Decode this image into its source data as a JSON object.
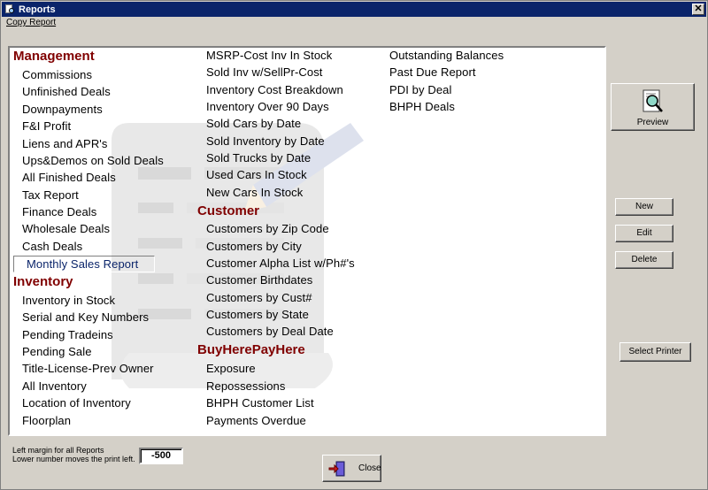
{
  "window": {
    "title": "Reports",
    "close_glyph": "✕"
  },
  "menu": {
    "copy_report": "Copy Report"
  },
  "columns": {
    "col1": {
      "management_header": "Management",
      "management_items": [
        "Commissions",
        "Unfinished Deals",
        "Downpayments",
        "F&I Profit",
        "Liens and APR's",
        "Ups&Demos on Sold Deals",
        "All Finished Deals",
        "Tax Report",
        "Finance Deals",
        "Wholesale Deals",
        "Cash Deals"
      ],
      "selected_item": "Monthly Sales Report",
      "inventory_header": "Inventory",
      "inventory_items": [
        "Inventory in Stock",
        "Serial and Key Numbers",
        "Pending Tradeins",
        "Pending Sale",
        "Title-License-Prev Owner",
        "All Inventory",
        "Location of Inventory",
        "Floorplan"
      ]
    },
    "col2": {
      "inventory_items": [
        "MSRP-Cost Inv In Stock",
        "Sold Inv w/SellPr-Cost",
        "Inventory Cost Breakdown",
        "Inventory Over 90 Days",
        "Sold Cars by Date",
        "Sold Inventory by Date",
        "Sold Trucks by Date",
        "Used Cars In Stock",
        "New Cars In Stock"
      ],
      "customer_header": "Customer",
      "customer_items": [
        "Customers by Zip Code",
        "Customers by City",
        "Customer Alpha List w/Ph#'s",
        "Customer Birthdates",
        "Customers by Cust#",
        "Customers by State",
        "Customers by Deal Date"
      ],
      "bhph_header": "BuyHerePayHere",
      "bhph_items": [
        "Exposure",
        "Repossessions",
        "BHPH Customer List",
        "Payments Overdue"
      ]
    },
    "col3": {
      "items": [
        "Outstanding Balances",
        "Past Due Report",
        "PDI by Deal",
        "BHPH Deals"
      ]
    }
  },
  "buttons": {
    "preview": "Preview",
    "new": "New",
    "edit": "Edit",
    "delete": "Delete",
    "select_printer": "Select Printer",
    "close": "Close"
  },
  "margin": {
    "label_line1": "Left margin for all Reports",
    "label_line2": "Lower number moves the print left.",
    "value": "-500"
  },
  "icons": {
    "preview": "magnifier-report-icon",
    "close": "exit-door-icon",
    "title": "report-icon"
  },
  "colors": {
    "titlebar": "#0a246a",
    "section_header": "#800000",
    "selected_text": "#0a246a",
    "face": "#d4d0c8"
  }
}
